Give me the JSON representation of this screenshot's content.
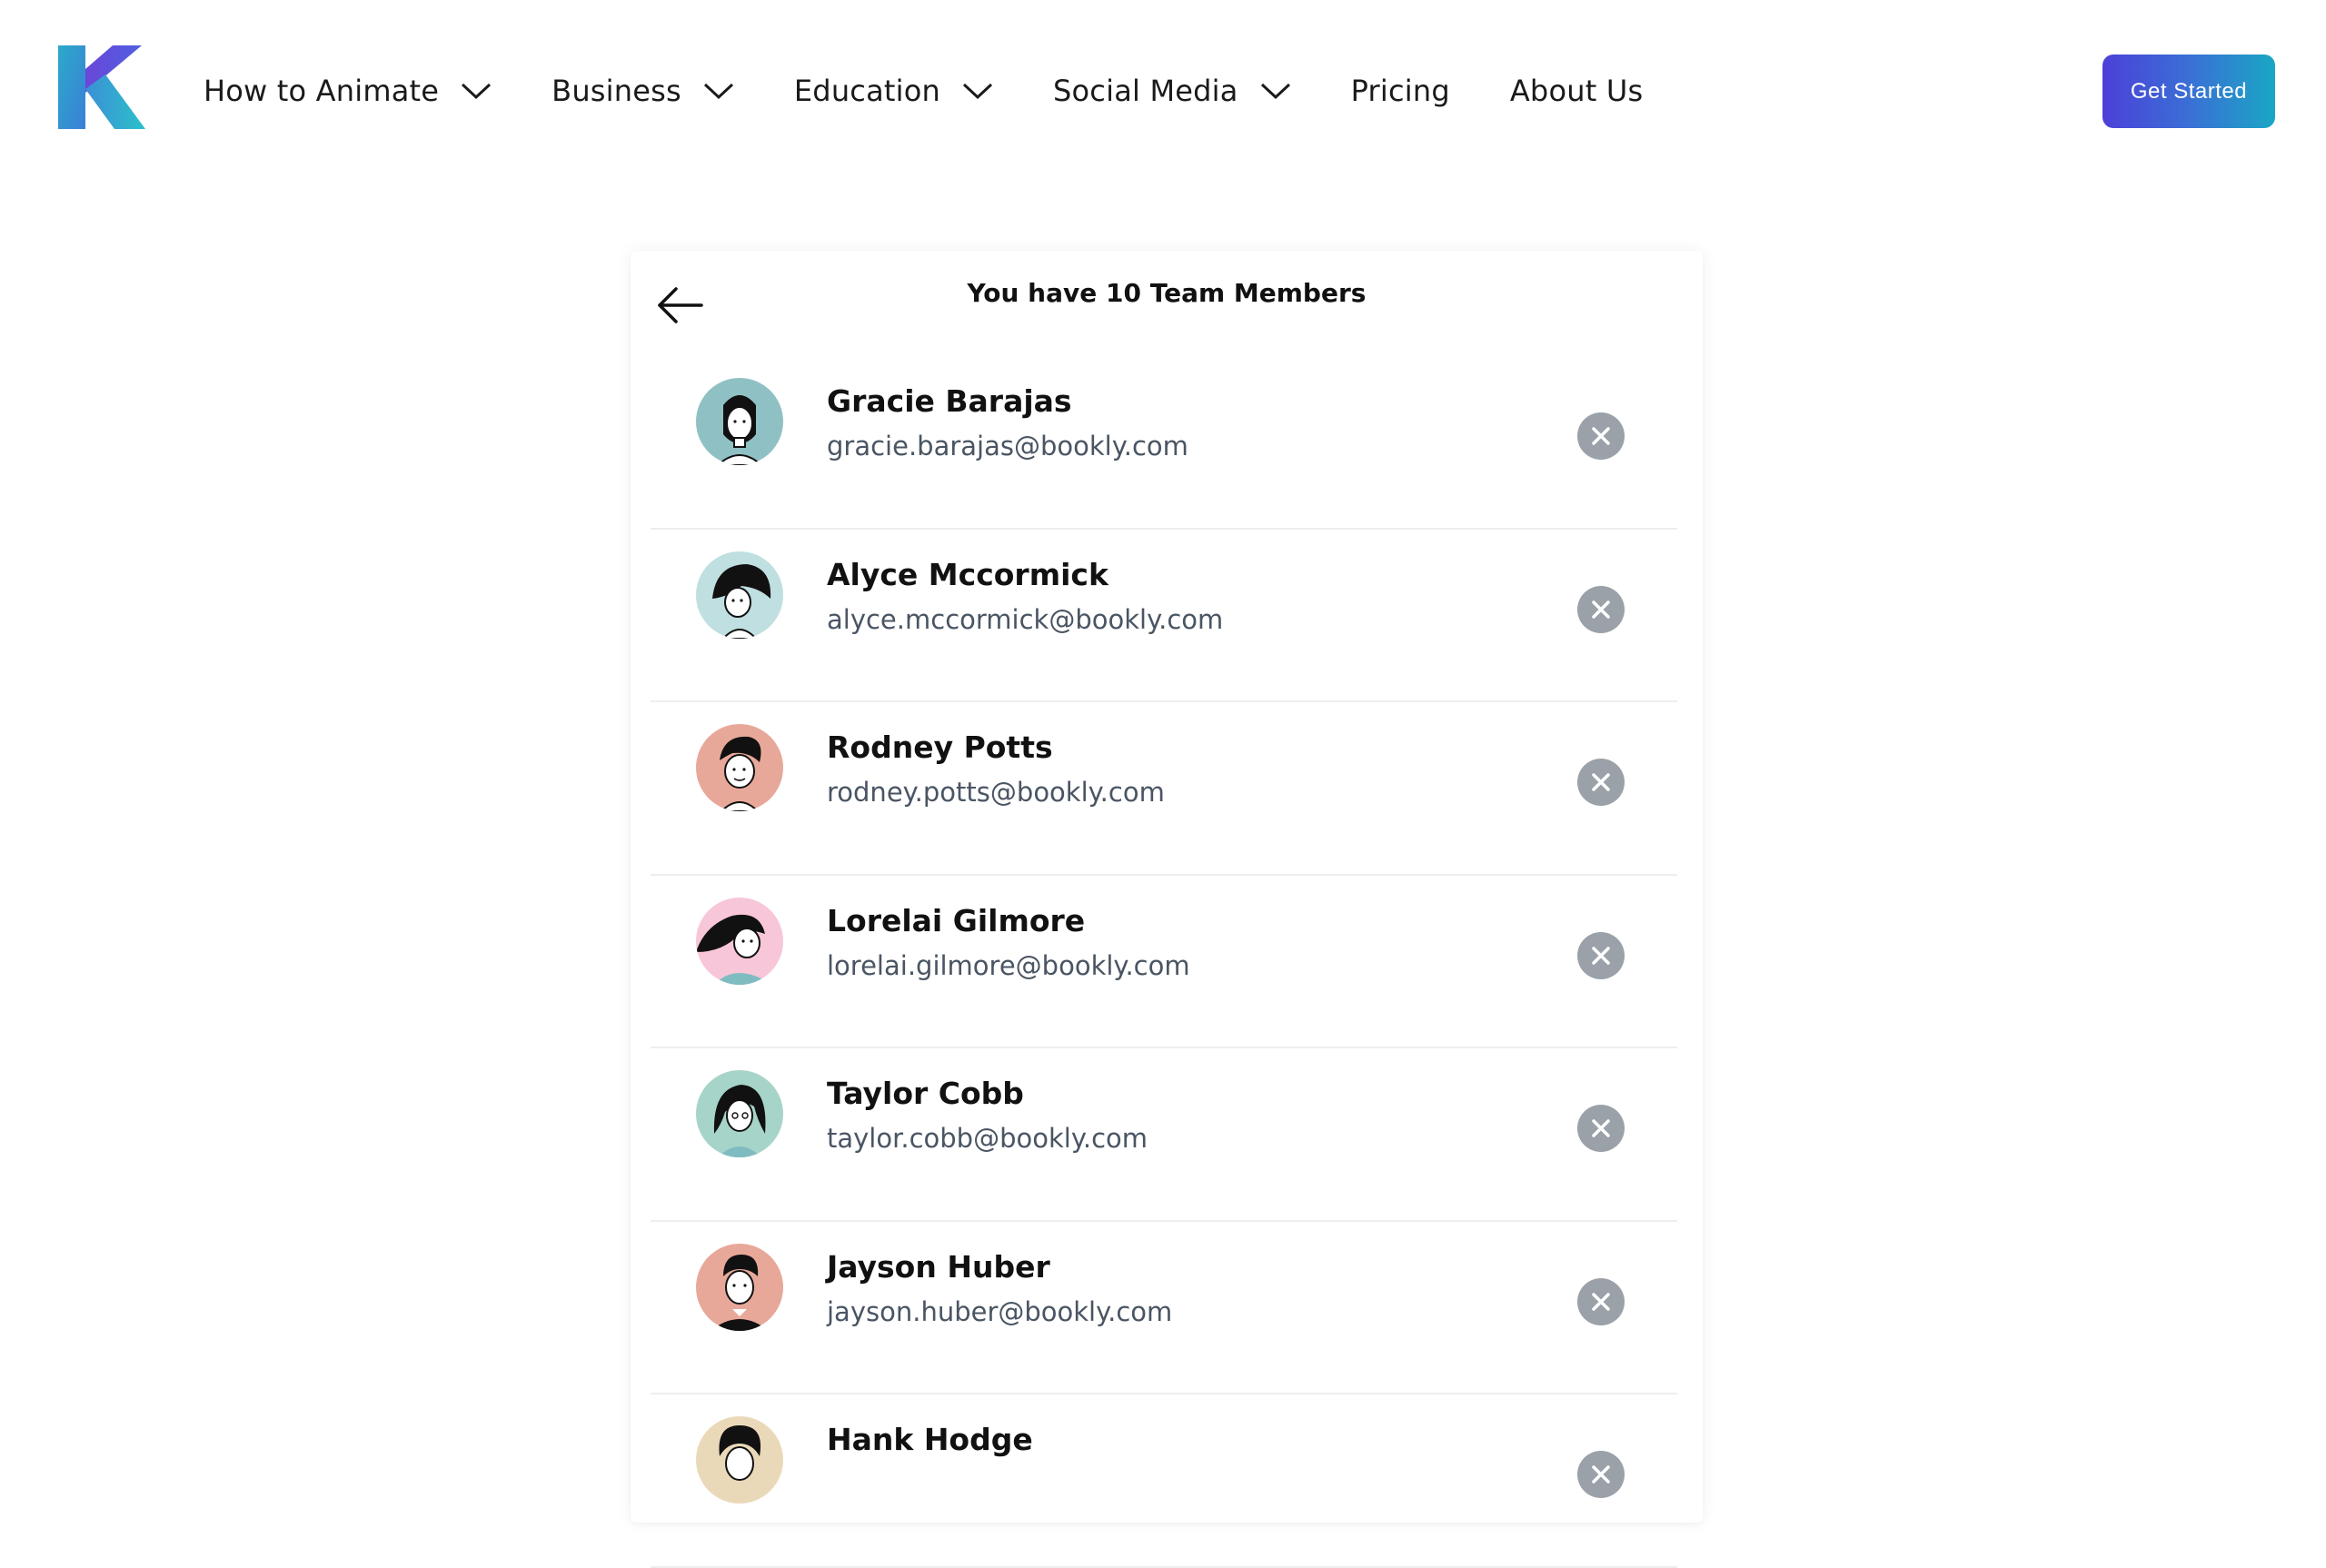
{
  "header": {
    "logo_icon": "k-logo-icon",
    "nav": [
      {
        "label": "How to Animate",
        "has_dropdown": true
      },
      {
        "label": "Business",
        "has_dropdown": true
      },
      {
        "label": "Education",
        "has_dropdown": true
      },
      {
        "label": "Social Media",
        "has_dropdown": true
      },
      {
        "label": "Pricing",
        "has_dropdown": false
      },
      {
        "label": "About Us",
        "has_dropdown": false
      }
    ],
    "cta_label": "Get Started"
  },
  "team": {
    "title": "You have 10 Team Members",
    "back_icon": "arrow-left-icon",
    "remove_icon": "close-icon",
    "members": [
      {
        "name": "Gracie Barajas",
        "email": "gracie.barajas@bookly.com",
        "avatar_color": "#8fc1c4"
      },
      {
        "name": "Alyce Mccormick",
        "email": "alyce.mccormick@bookly.com",
        "avatar_color": "#bfdfe0"
      },
      {
        "name": "Rodney Potts",
        "email": "rodney.potts@bookly.com",
        "avatar_color": "#e8a899"
      },
      {
        "name": "Lorelai Gilmore",
        "email": "lorelai.gilmore@bookly.com",
        "avatar_color": "#f7c6d8"
      },
      {
        "name": "Taylor Cobb",
        "email": "taylor.cobb@bookly.com",
        "avatar_color": "#a7d4c9"
      },
      {
        "name": "Jayson Huber",
        "email": "jayson.huber@bookly.com",
        "avatar_color": "#e8a899"
      },
      {
        "name": "Hank Hodge",
        "email": "",
        "avatar_color": "#ead9b8"
      }
    ]
  },
  "colors": {
    "accent_gradient_start": "#4c40d8",
    "accent_gradient_end": "#1aa7c4",
    "remove_button": "#9aa1a8"
  }
}
